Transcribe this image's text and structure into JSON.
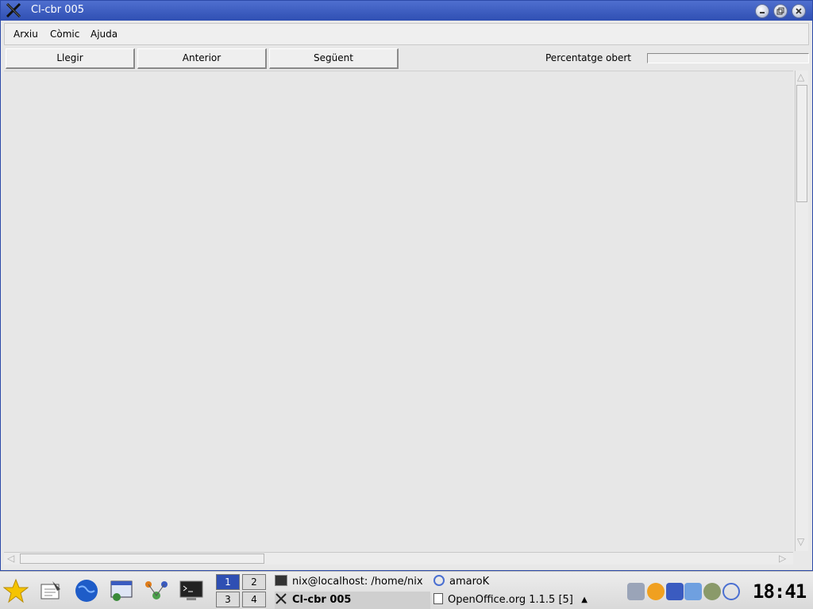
{
  "window": {
    "title": "Cl-cbr 005",
    "buttons": [
      "minimize",
      "maximize",
      "close"
    ]
  },
  "menubar": {
    "items": [
      "Arxiu",
      "Còmic",
      "Ajuda"
    ]
  },
  "toolbar": {
    "read_label": "Llegir",
    "prev_label": "Anterior",
    "next_label": "Següent",
    "percent_label": "Percentatge obert",
    "percent_value": 0
  },
  "taskbar": {
    "pager": [
      "1",
      "2",
      "3",
      "4"
    ],
    "active_desktop": "1",
    "tasks": [
      {
        "label": "nix@localhost: /home/nix",
        "icon": "terminal-icon"
      },
      {
        "label": "amaroK",
        "icon": "amarok-icon"
      },
      {
        "label": "Cl-cbr 005",
        "icon": "x-icon",
        "active": true
      },
      {
        "label": "OpenOffice.org 1.1.5 [5]",
        "icon": "document-icon"
      }
    ],
    "clock": "18:41"
  },
  "colors": {
    "titlebar": "#3a5bc0",
    "window_bg": "#e8e8e8",
    "pager_active": "#2f4fb3"
  }
}
